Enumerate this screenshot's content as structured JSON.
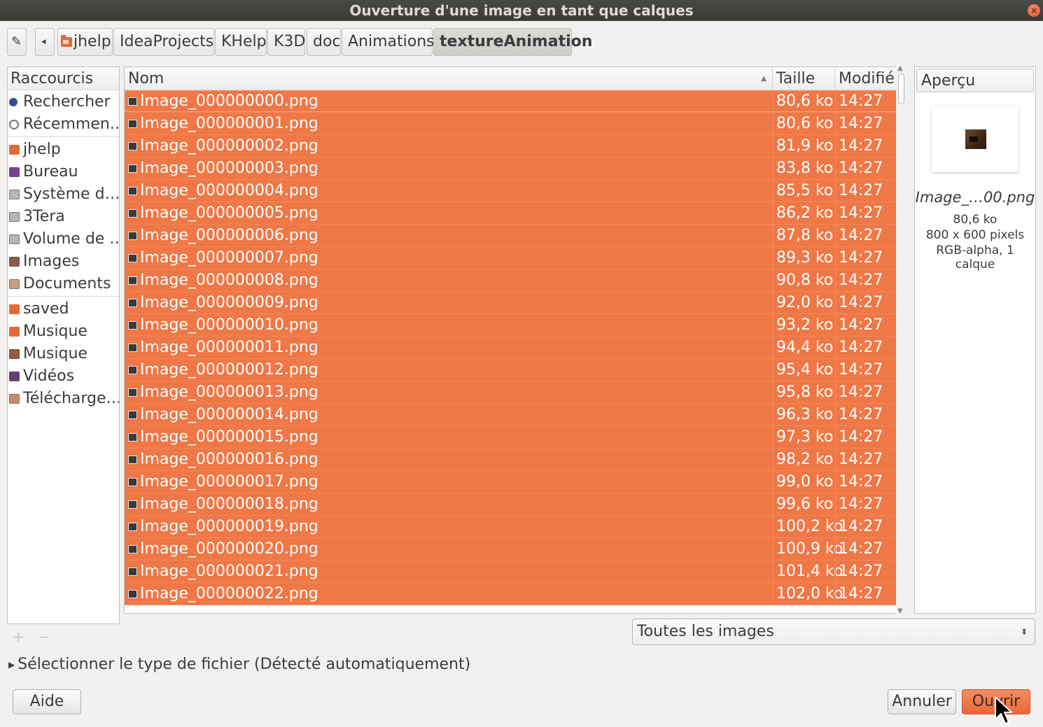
{
  "window": {
    "title": "Ouverture d'une image en tant que calques",
    "close_label": "×"
  },
  "pathbar": {
    "edit_label": "✎",
    "back_label": "◂",
    "crumbs": [
      "jhelp",
      "IdeaProjects",
      "KHelp",
      "K3D",
      "doc",
      "Animations",
      "textureAnimation"
    ]
  },
  "places": {
    "header": "Raccourcis",
    "items": [
      {
        "label": "Rechercher",
        "icon": "search-icon"
      },
      {
        "label": "Récemmen…",
        "icon": "recent-icon"
      },
      {
        "label": "jhelp",
        "icon": "home-folder-icon"
      },
      {
        "label": "Bureau",
        "icon": "desktop-icon"
      },
      {
        "label": "Système d…",
        "icon": "drive-icon"
      },
      {
        "label": "3Tera",
        "icon": "drive-icon"
      },
      {
        "label": "Volume de …",
        "icon": "drive-icon"
      },
      {
        "label": "Images",
        "icon": "pictures-icon"
      },
      {
        "label": "Documents",
        "icon": "documents-icon"
      },
      {
        "label": "saved",
        "icon": "folder-icon"
      },
      {
        "label": "Musique",
        "icon": "folder-icon"
      },
      {
        "label": "Musique",
        "icon": "music-icon"
      },
      {
        "label": "Vidéos",
        "icon": "videos-icon"
      },
      {
        "label": "Télécharge…",
        "icon": "downloads-icon"
      }
    ],
    "add_label": "+",
    "remove_label": "−"
  },
  "filelist": {
    "columns": {
      "name": "Nom",
      "size": "Taille",
      "modified": "Modifié"
    },
    "rows": [
      {
        "name": "Image_000000000.png",
        "size": "80,6 ko",
        "modified": "14:27"
      },
      {
        "name": "Image_000000001.png",
        "size": "80,6 ko",
        "modified": "14:27"
      },
      {
        "name": "Image_000000002.png",
        "size": "81,9 ko",
        "modified": "14:27"
      },
      {
        "name": "Image_000000003.png",
        "size": "83,8 ko",
        "modified": "14:27"
      },
      {
        "name": "Image_000000004.png",
        "size": "85,5 ko",
        "modified": "14:27"
      },
      {
        "name": "Image_000000005.png",
        "size": "86,2 ko",
        "modified": "14:27"
      },
      {
        "name": "Image_000000006.png",
        "size": "87,8 ko",
        "modified": "14:27"
      },
      {
        "name": "Image_000000007.png",
        "size": "89,3 ko",
        "modified": "14:27"
      },
      {
        "name": "Image_000000008.png",
        "size": "90,8 ko",
        "modified": "14:27"
      },
      {
        "name": "Image_000000009.png",
        "size": "92,0 ko",
        "modified": "14:27"
      },
      {
        "name": "Image_000000010.png",
        "size": "93,2 ko",
        "modified": "14:27"
      },
      {
        "name": "Image_000000011.png",
        "size": "94,4 ko",
        "modified": "14:27"
      },
      {
        "name": "Image_000000012.png",
        "size": "95,4 ko",
        "modified": "14:27"
      },
      {
        "name": "Image_000000013.png",
        "size": "95,8 ko",
        "modified": "14:27"
      },
      {
        "name": "Image_000000014.png",
        "size": "96,3 ko",
        "modified": "14:27"
      },
      {
        "name": "Image_000000015.png",
        "size": "97,3 ko",
        "modified": "14:27"
      },
      {
        "name": "Image_000000016.png",
        "size": "98,2 ko",
        "modified": "14:27"
      },
      {
        "name": "Image_000000017.png",
        "size": "99,0 ko",
        "modified": "14:27"
      },
      {
        "name": "Image_000000018.png",
        "size": "99,6 ko",
        "modified": "14:27"
      },
      {
        "name": "Image_000000019.png",
        "size": "100,2 ko",
        "modified": "14:27"
      },
      {
        "name": "Image_000000020.png",
        "size": "100,9 ko",
        "modified": "14:27"
      },
      {
        "name": "Image_000000021.png",
        "size": "101,4 ko",
        "modified": "14:27"
      },
      {
        "name": "Image_000000022.png",
        "size": "102,0 ko",
        "modified": "14:27"
      }
    ],
    "selection_color": "#f07746"
  },
  "preview": {
    "header": "Aperçu",
    "name": "Image_…00.png",
    "size": "80,6 ko",
    "dimensions": "800 x 600 pixels",
    "mode": "RGB-alpha, 1 calque"
  },
  "filter": {
    "value": "Toutes les images"
  },
  "expander": {
    "label": "Sélectionner le type de fichier (Détecté automatiquement)"
  },
  "buttons": {
    "help": "Aide",
    "cancel": "Annuler",
    "open": "Ouvrir"
  },
  "colors": {
    "accent": "#f07746",
    "titlebar": "#3c3b37"
  }
}
